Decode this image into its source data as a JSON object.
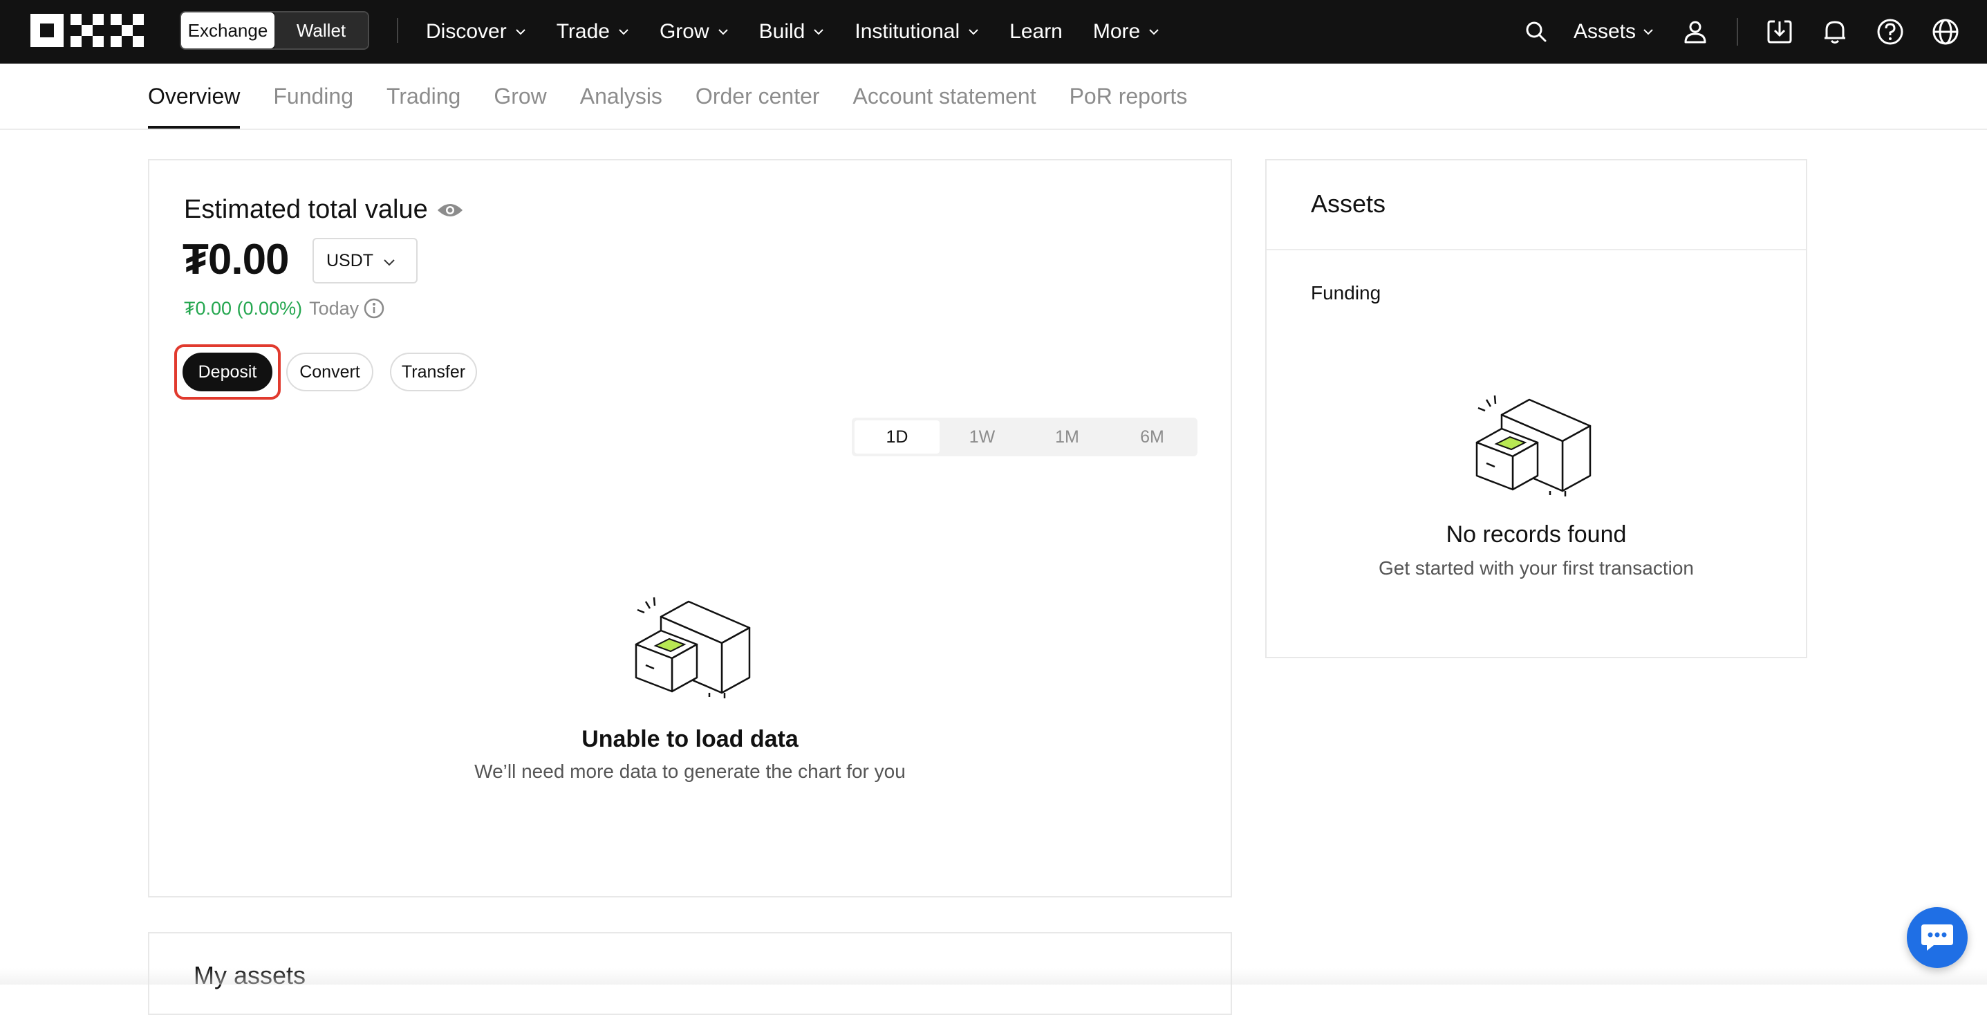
{
  "topnav": {
    "segment": {
      "exchange_label": "Exchange",
      "wallet_label": "Wallet"
    },
    "menu": [
      {
        "label": "Discover",
        "dropdown": true
      },
      {
        "label": "Trade",
        "dropdown": true
      },
      {
        "label": "Grow",
        "dropdown": true
      },
      {
        "label": "Build",
        "dropdown": true
      },
      {
        "label": "Institutional",
        "dropdown": true
      },
      {
        "label": "Learn",
        "dropdown": false
      },
      {
        "label": "More",
        "dropdown": true
      }
    ],
    "assets_label": "Assets",
    "icons": [
      "search-icon",
      "user-icon",
      "download-icon",
      "bell-icon",
      "help-icon",
      "globe-icon"
    ]
  },
  "subtabs": {
    "items": [
      "Overview",
      "Funding",
      "Trading",
      "Grow",
      "Analysis",
      "Order center",
      "Account statement",
      "PoR reports"
    ],
    "active": "Overview"
  },
  "overview": {
    "estimated_label": "Estimated total value",
    "total_value": "₮0.00",
    "currency": "USDT",
    "pnl": "₮0.00 (0.00%)",
    "pnl_period": "Today",
    "actions": {
      "deposit": "Deposit",
      "convert": "Convert",
      "transfer": "Transfer"
    },
    "ranges": [
      "1D",
      "1W",
      "1M",
      "6M"
    ],
    "active_range": "1D",
    "empty_title": "Unable to load data",
    "empty_subtitle": "We’ll need more data to generate the chart for you"
  },
  "assets_panel": {
    "title": "Assets",
    "section": "Funding",
    "empty_title": "No records found",
    "empty_subtitle": "Get started with your first transaction"
  },
  "my_assets": {
    "title": "My assets"
  },
  "colors": {
    "nav_bg": "#121212",
    "gain": "#25a750",
    "highlight": "#e13a2e",
    "chat_fab": "#1f6fe5",
    "illus_accent": "#b8e853"
  }
}
